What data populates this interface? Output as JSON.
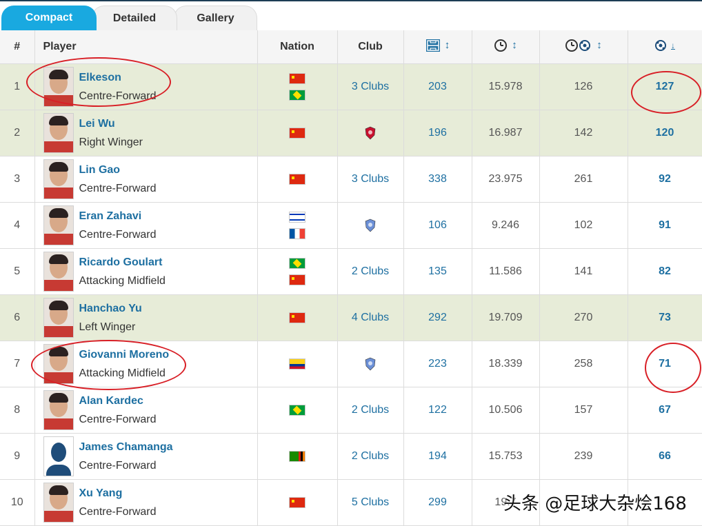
{
  "tabs": [
    {
      "label": "Compact",
      "active": true
    },
    {
      "label": "Detailed",
      "active": false
    },
    {
      "label": "Gallery",
      "active": false
    }
  ],
  "columns": {
    "rank": "#",
    "player": "Player",
    "nation": "Nation",
    "club": "Club",
    "apps_icon": "pitch-icon",
    "minutes_icon": "clock-icon",
    "mins_per_goal_icon": "clock-ball-icon",
    "goals_icon": "ball-icon"
  },
  "colors": {
    "accent": "#19a9e0",
    "link": "#1d6fa1",
    "highlight_row": "#e7ecd8",
    "annotation": "#d81f26"
  },
  "rows": [
    {
      "rank": "1",
      "name": "Elkeson",
      "position": "Centre-Forward",
      "nations": [
        "cn",
        "br"
      ],
      "club": "3 Clubs",
      "club_icon": "",
      "apps": "203",
      "minutes_per_goal": "15.978",
      "goals_per_x": "126",
      "goals": "127",
      "highlight": true
    },
    {
      "rank": "2",
      "name": "Lei Wu",
      "position": "Right Winger",
      "nations": [
        "cn"
      ],
      "club": "",
      "club_icon": "shanghai-sipg-crest-icon",
      "apps": "196",
      "minutes_per_goal": "16.987",
      "goals_per_x": "142",
      "goals": "120",
      "highlight": true
    },
    {
      "rank": "3",
      "name": "Lin Gao",
      "position": "Centre-Forward",
      "nations": [
        "cn"
      ],
      "club": "3 Clubs",
      "club_icon": "",
      "apps": "338",
      "minutes_per_goal": "23.975",
      "goals_per_x": "261",
      "goals": "92",
      "highlight": false
    },
    {
      "rank": "4",
      "name": "Eran Zahavi",
      "position": "Centre-Forward",
      "nations": [
        "il",
        "fr"
      ],
      "club": "",
      "club_icon": "club-crest-icon",
      "apps": "106",
      "minutes_per_goal": "9.246",
      "goals_per_x": "102",
      "goals": "91",
      "highlight": false
    },
    {
      "rank": "5",
      "name": "Ricardo Goulart",
      "position": "Attacking Midfield",
      "nations": [
        "br",
        "cn"
      ],
      "club": "2 Clubs",
      "club_icon": "",
      "apps": "135",
      "minutes_per_goal": "11.586",
      "goals_per_x": "141",
      "goals": "82",
      "highlight": false
    },
    {
      "rank": "6",
      "name": "Hanchao Yu",
      "position": "Left Winger",
      "nations": [
        "cn"
      ],
      "club": "4 Clubs",
      "club_icon": "",
      "apps": "292",
      "minutes_per_goal": "19.709",
      "goals_per_x": "270",
      "goals": "73",
      "highlight": true
    },
    {
      "rank": "7",
      "name": "Giovanni Moreno",
      "position": "Attacking Midfield",
      "nations": [
        "co"
      ],
      "club": "",
      "club_icon": "shanghai-shenhua-crest-icon",
      "apps": "223",
      "minutes_per_goal": "18.339",
      "goals_per_x": "258",
      "goals": "71",
      "highlight": false
    },
    {
      "rank": "8",
      "name": "Alan Kardec",
      "position": "Centre-Forward",
      "nations": [
        "br"
      ],
      "club": "2 Clubs",
      "club_icon": "",
      "apps": "122",
      "minutes_per_goal": "10.506",
      "goals_per_x": "157",
      "goals": "67",
      "highlight": false
    },
    {
      "rank": "9",
      "name": "James Chamanga",
      "position": "Centre-Forward",
      "nations": [
        "zm"
      ],
      "club": "2 Clubs",
      "club_icon": "",
      "apps": "194",
      "minutes_per_goal": "15.753",
      "goals_per_x": "239",
      "goals": "66",
      "highlight": false
    },
    {
      "rank": "10",
      "name": "Xu Yang",
      "position": "Centre-Forward",
      "nations": [
        "cn"
      ],
      "club": "5 Clubs",
      "club_icon": "",
      "apps": "299",
      "minutes_per_goal": "19.7",
      "goals_per_x": "",
      "goals": "",
      "highlight": false
    }
  ],
  "watermark": "头条 @足球大杂烩168"
}
